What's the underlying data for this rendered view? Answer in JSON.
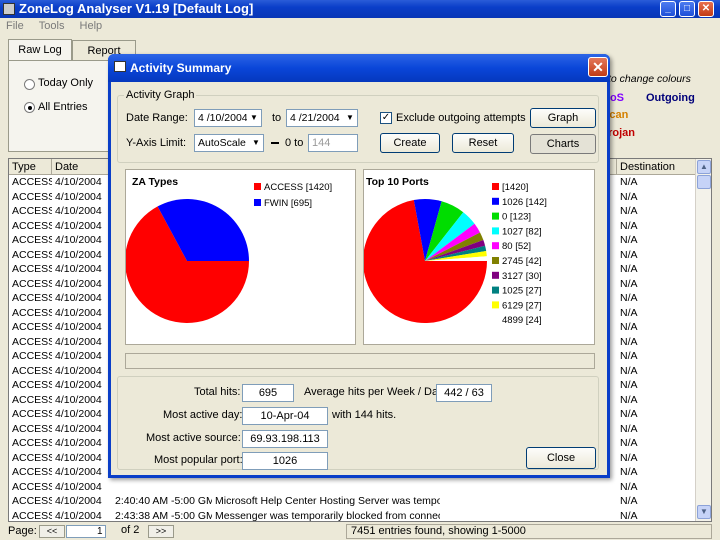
{
  "window": {
    "title": "ZoneLog Analyser V1.19  [Default Log]"
  },
  "menu": [
    "File",
    "Tools",
    "Help"
  ],
  "tabs": [
    "Raw Log",
    "Report"
  ],
  "filter": {
    "today": "Today Only",
    "all": "All Entries"
  },
  "legend_colors": {
    "hint": "to change colours",
    "dos": "DoS",
    "outgoing": "Outgoing",
    "scan": "Scan",
    "trojan": "Trojan"
  },
  "grid": {
    "headers": [
      "Type",
      "Date",
      "Destination"
    ],
    "rows": [
      {
        "type": "ACCESS",
        "date": "4/10/2004",
        "dest": "N/A"
      },
      {
        "type": "ACCESS",
        "date": "4/10/2004",
        "dest": "N/A"
      },
      {
        "type": "ACCESS",
        "date": "4/10/2004",
        "dest": "N/A"
      },
      {
        "type": "ACCESS",
        "date": "4/10/2004",
        "dest": "N/A"
      },
      {
        "type": "ACCESS",
        "date": "4/10/2004",
        "dest": "N/A"
      },
      {
        "type": "ACCESS",
        "date": "4/10/2004",
        "dest": "N/A"
      },
      {
        "type": "ACCESS",
        "date": "4/10/2004",
        "dest": "N/A"
      },
      {
        "type": "ACCESS",
        "date": "4/10/2004",
        "dest": "N/A"
      },
      {
        "type": "ACCESS",
        "date": "4/10/2004",
        "dest": "N/A"
      },
      {
        "type": "ACCESS",
        "date": "4/10/2004",
        "dest": "N/A"
      },
      {
        "type": "ACCESS",
        "date": "4/10/2004",
        "dest": "N/A"
      },
      {
        "type": "ACCESS",
        "date": "4/10/2004",
        "dest": "N/A"
      },
      {
        "type": "ACCESS",
        "date": "4/10/2004",
        "dest": "N/A"
      },
      {
        "type": "ACCESS",
        "date": "4/10/2004",
        "dest": "N/A"
      },
      {
        "type": "ACCESS",
        "date": "4/10/2004",
        "dest": "N/A"
      },
      {
        "type": "ACCESS",
        "date": "4/10/2004",
        "dest": "N/A"
      },
      {
        "type": "ACCESS",
        "date": "4/10/2004",
        "dest": "N/A"
      },
      {
        "type": "ACCESS",
        "date": "4/10/2004",
        "dest": "N/A"
      },
      {
        "type": "ACCESS",
        "date": "4/10/2004",
        "dest": "N/A"
      },
      {
        "type": "ACCESS",
        "date": "4/10/2004",
        "dest": "N/A"
      },
      {
        "type": "ACCESS",
        "date": "4/10/2004",
        "dest": "N/A"
      },
      {
        "type": "ACCESS",
        "date": "4/10/2004",
        "dest": "N/A"
      },
      {
        "type": "ACCESS",
        "date": "4/10/2004",
        "time": "2:40:40 AM -5:00 GM",
        "msg": "Microsoft Help Center Hosting Server was temporarily",
        "dest": "N/A"
      },
      {
        "type": "ACCESS",
        "date": "4/10/2004",
        "time": "2:43:38 AM -5:00 GM",
        "msg": "Messenger was temporarily blocked from connecting t",
        "dest": "N/A"
      }
    ]
  },
  "pager": {
    "label": "Page:",
    "prev": "<<",
    "page": "1",
    "of": "of 2",
    "next": ">>",
    "status": "7451 entries found, showing 1-5000"
  },
  "dialog": {
    "title": "Activity Summary",
    "activity_graph": "Activity Graph",
    "date_range_label": "Date Range:",
    "date_from": "4 /10/2004",
    "to": "to",
    "date_to": "4 /21/2004",
    "exclude": "Exclude outgoing attempts",
    "graph_btn": "Graph",
    "yaxis_label": "Y-Axis Limit:",
    "yaxis_value": "AutoScale",
    "range_prefix": "0 to",
    "range_value": "144",
    "create_btn": "Create",
    "reset_btn": "Reset",
    "charts_btn": "Charts",
    "total_hits_label": "Total hits:",
    "total_hits": "695",
    "avg_label": "Average hits per Week / Day:",
    "avg_value": "442 / 63",
    "most_active_day_label": "Most active day:",
    "most_active_day": "10-Apr-04",
    "with_hits": "with 144 hits.",
    "most_active_source_label": "Most active source:",
    "most_active_source": "69.93.198.113",
    "popular_port_label": "Most popular port:",
    "popular_port": "1026",
    "close_btn": "Close"
  },
  "chart_data": [
    {
      "type": "pie",
      "title": "ZA Types",
      "series": [
        {
          "name": "ACCESS",
          "value": 1420,
          "label": "ACCESS [1420]",
          "color": "#ff0000"
        },
        {
          "name": "FWIN",
          "value": 695,
          "label": "FWIN [695]",
          "color": "#0000ff"
        }
      ]
    },
    {
      "type": "pie",
      "title": "Top 10 Ports",
      "series": [
        {
          "name": "1420",
          "value": 1420,
          "label": "[1420]",
          "color": "#ff0000"
        },
        {
          "name": "1026",
          "value": 142,
          "label": "1026 [142]",
          "color": "#0000ff"
        },
        {
          "name": "0",
          "value": 123,
          "label": "0 [123]",
          "color": "#00dd00"
        },
        {
          "name": "1027",
          "value": 82,
          "label": "1027 [82]",
          "color": "#00ffff"
        },
        {
          "name": "80",
          "value": 52,
          "label": "80 [52]",
          "color": "#ff00ff"
        },
        {
          "name": "2745",
          "value": 42,
          "label": "2745 [42]",
          "color": "#808000"
        },
        {
          "name": "3127",
          "value": 30,
          "label": "3127 [30]",
          "color": "#800080"
        },
        {
          "name": "1025",
          "value": 27,
          "label": "1025 [27]",
          "color": "#008080"
        },
        {
          "name": "6129",
          "value": 27,
          "label": "6129 [27]",
          "color": "#ffff00"
        },
        {
          "name": "4899",
          "value": 24,
          "label": "4899 [24]",
          "color": "#ffffff"
        }
      ]
    }
  ]
}
